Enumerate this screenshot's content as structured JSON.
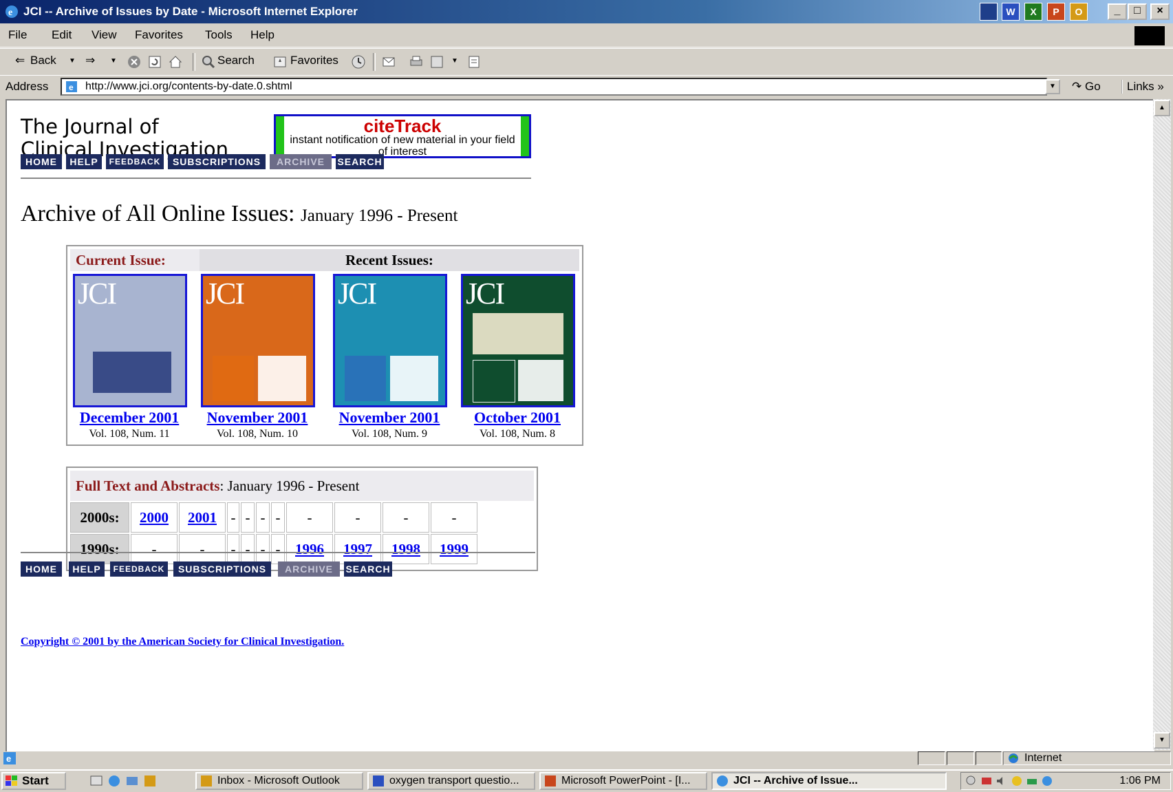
{
  "window": {
    "title": "JCI -- Archive of Issues by Date - Microsoft Internet Explorer",
    "quick_icons": [
      "W",
      "X",
      "P",
      "O"
    ],
    "min": "_",
    "max": "□",
    "close": "×"
  },
  "menu": [
    "File",
    "Edit",
    "View",
    "Favorites",
    "Tools",
    "Help"
  ],
  "toolbar": {
    "back": "Back",
    "search": "Search",
    "favorites": "Favorites"
  },
  "address": {
    "label": "Address",
    "url": "http://www.jci.org/contents-by-date.0.shtml",
    "go": "Go",
    "links": "Links »"
  },
  "page": {
    "journal_title_line1": "The Journal of",
    "journal_title_line2": "Clinical Investigation",
    "citetrack_title": "citeTrack",
    "citetrack_sub": "instant notification of new material in your field of interest",
    "nav": [
      "HOME",
      "HELP",
      "FEEDBACK",
      "SUBSCRIPTIONS",
      "ARCHIVE",
      "SEARCH"
    ],
    "nav_active": "ARCHIVE",
    "heading": "Archive of All Online Issues:",
    "heading_sub": "January 1996 - Present",
    "current_issue_label": "Current Issue:",
    "recent_issues_label": "Recent Issues:",
    "issues": [
      {
        "month": "December 2001",
        "vol": "Vol. 108, Num. 11",
        "cover_color": "#a8b4d0"
      },
      {
        "month": "November 2001",
        "vol": "Vol. 108, Num. 10",
        "cover_color": "#d9681a"
      },
      {
        "month": "November 2001",
        "vol": "Vol. 108, Num. 9",
        "cover_color": "#1d8fb2"
      },
      {
        "month": "October 2001",
        "vol": "Vol. 108, Num. 8",
        "cover_color": "#0f4d2e"
      }
    ],
    "fulltext_label": "Full Text and Abstracts",
    "fulltext_range": ": January 1996 - Present",
    "decades": [
      {
        "label": "2000s",
        "cells": [
          "2000",
          "2001",
          "-",
          "-",
          "-",
          "-",
          "-",
          "-",
          "-",
          "-"
        ]
      },
      {
        "label": "1990s",
        "cells": [
          "-",
          "-",
          "-",
          "-",
          "-",
          "-",
          "1996",
          "1997",
          "1998",
          "1999"
        ]
      }
    ],
    "copyright": "Copyright © 2001 by the American Society for Clinical Investigation."
  },
  "status": {
    "zone": "Internet"
  },
  "taskbar": {
    "start": "Start",
    "tasks": [
      {
        "label": "Inbox - Microsoft Outlook",
        "active": false
      },
      {
        "label": "oxygen transport questio...",
        "active": false
      },
      {
        "label": "Microsoft PowerPoint - [I...",
        "active": false
      },
      {
        "label": "JCI -- Archive of Issue...",
        "active": true
      }
    ],
    "clock": "1:06 PM"
  }
}
